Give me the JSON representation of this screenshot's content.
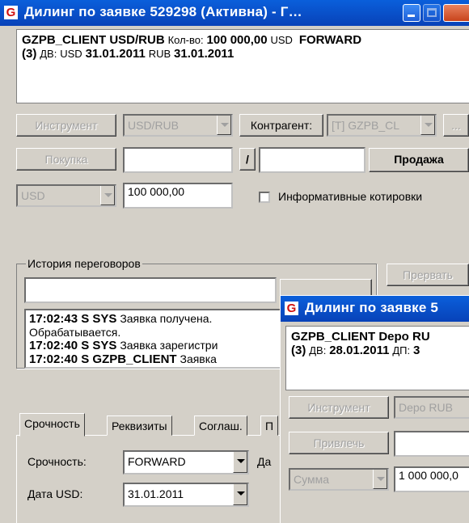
{
  "win1": {
    "title": "Дилинг по заявке 529298 (Активна) - Г…",
    "icon_letter": "G",
    "info": {
      "client": "GZPB_CLIENT USD/RUB",
      "qty_label": "Кол-во:",
      "qty_value": "100 000,00",
      "qty_cur": "USD",
      "type": "FORWARD",
      "line2_prefix": "(3)",
      "dv_label": "ДВ:",
      "dv_cur1": "USD",
      "dv_date1": "31.01.2011",
      "dv_cur2": "RUB",
      "dv_date2": "31.01.2011"
    },
    "instrument_btn": "Инструмент",
    "instrument_value": "USD/RUB",
    "counterparty_label": "Контрагент:",
    "counterparty_value": "[T] GZPB_CL",
    "ellipsis_btn": "...",
    "buy_btn": "Покупка",
    "slash": "/",
    "sell_btn": "Продажа",
    "currency_value": "USD",
    "amount_value": "100 000,00",
    "info_quotes_label": "Информативные котировки",
    "history_title": "История переговоров",
    "abort_btn": "Прервать",
    "log": [
      {
        "time": "17:02:43",
        "flag": "S",
        "who": "SYS",
        "text": "Заявка получена."
      },
      {
        "cont": "Обрабатывается."
      },
      {
        "time": "17:02:40",
        "flag": "S",
        "who": "SYS",
        "text": "Заявка зарегистри"
      },
      {
        "time": "17:02:40",
        "flag": "S",
        "who": "GZPB_CLIENT",
        "text": "Заявка"
      }
    ],
    "tabs": [
      "Срочность",
      "Реквизиты",
      "Соглаш.",
      "П"
    ],
    "urgency_label": "Срочность:",
    "urgency_value": "FORWARD",
    "date_label_cut": "Да",
    "date_usd_label": "Дата USD:",
    "date_usd_value": "31.01.2011"
  },
  "win2": {
    "title": "Дилинг по заявке 5",
    "icon_letter": "G",
    "info": {
      "client": "GZPB_CLIENT Depo RU",
      "line2_prefix": "(3)",
      "dv_label": "ДВ:",
      "dv_date": "28.01.2011",
      "dp_label": "ДП:",
      "dp_value": "3"
    },
    "instrument_btn": "Инструмент",
    "instrument_value": "Depo RUB",
    "attract_btn": "Привлечь",
    "sum_value": "Сумма",
    "amount_value": "1 000 000,0"
  }
}
